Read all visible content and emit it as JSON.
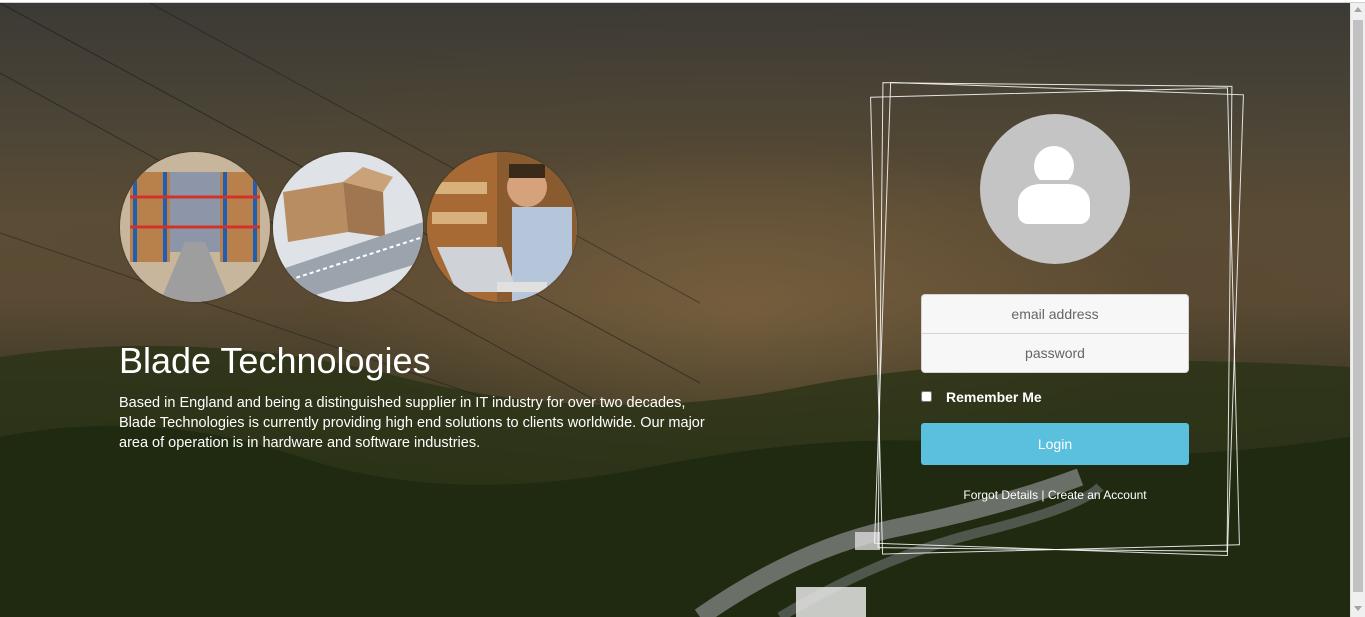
{
  "brand": {
    "title": "Blade Technologies",
    "description": "Based in England and being a distinguished supplier in IT industry for over two decades, Blade Technologies is currently providing high end solutions to clients worldwide. Our major area of operation is in hardware and software industries."
  },
  "images": [
    {
      "icon": "warehouse-image"
    },
    {
      "icon": "conveyor-box-image"
    },
    {
      "icon": "laptop-worker-image"
    }
  ],
  "login": {
    "avatar_icon": "user-icon",
    "email_placeholder": "email address",
    "password_placeholder": "password",
    "remember_label": "Remember Me",
    "login_label": "Login",
    "forgot_label": "Forgot Details",
    "separator": "|",
    "create_label": "Create an Account"
  },
  "colors": {
    "login_button": "#5bc0de",
    "avatar_bg": "#c4c4c4"
  }
}
